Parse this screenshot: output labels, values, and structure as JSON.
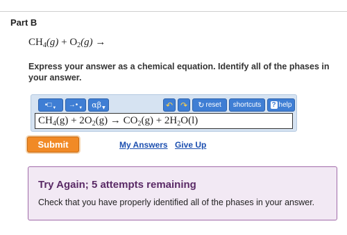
{
  "part": {
    "title": "Part B"
  },
  "problem": {
    "reactant1": "CH",
    "reactant1_sub": "4",
    "reactant1_phase": "(g)",
    "plus": "+",
    "reactant2": "O",
    "reactant2_sub": "2",
    "reactant2_phase": "(g)",
    "arrow": "→"
  },
  "instruction": "Express your answer as a chemical equation. Identify all of the phases in your answer.",
  "toolbar": {
    "templates_icon": "▪□",
    "arrows_icon": "→•",
    "greek_icon": "αβ",
    "undo_icon": "↶",
    "redo_icon": "↷",
    "reset_icon": "↻",
    "reset_label": "reset",
    "shortcuts_label": "shortcuts",
    "help_q": "?",
    "help_label": "help"
  },
  "answer": {
    "p1": "CH",
    "s1": "4",
    "p2": "(g) + 2O",
    "s2": "2",
    "p3": "(g) → CO",
    "s3": "2",
    "p4": "(g) + 2H",
    "s4": "2",
    "p5": "O(l)"
  },
  "actions": {
    "submit_label": "Submit",
    "my_answers_label": "My Answers",
    "give_up_label": "Give Up"
  },
  "feedback": {
    "title": "Try Again; 5 attempts remaining",
    "message": "Check that you have properly identified all of the phases in your answer."
  },
  "colors": {
    "submit": "#f18a26",
    "toolbar_button": "#3f7ed4",
    "feedback_bg": "#f2e9f4",
    "feedback_border": "#a06aa8",
    "feedback_title": "#5a2a66",
    "link": "#1c4fb0"
  }
}
